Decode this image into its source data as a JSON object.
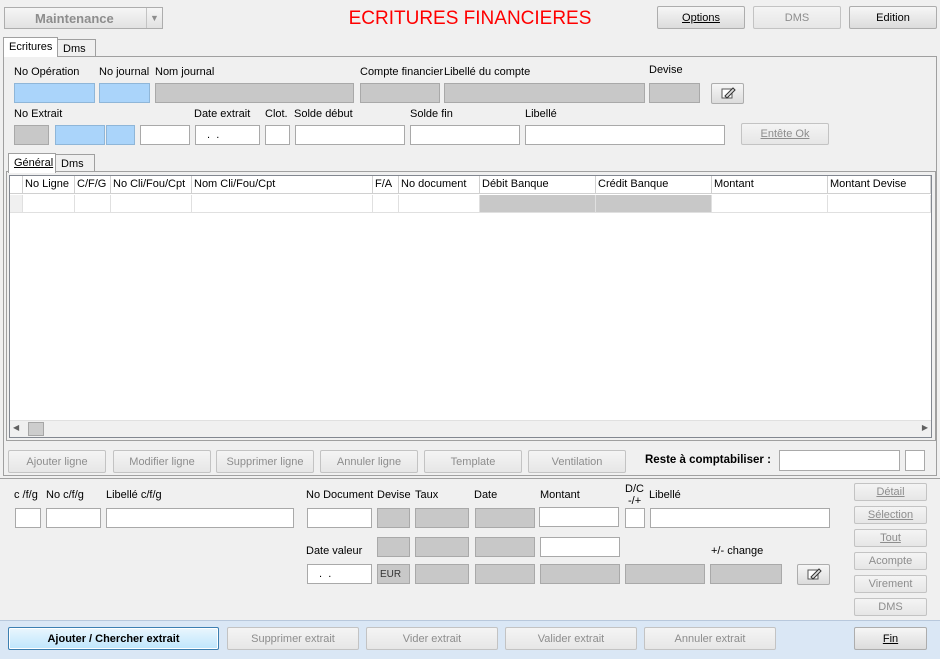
{
  "header": {
    "module_select": "Maintenance",
    "title": "ECRITURES FINANCIERES",
    "options_label": "Options",
    "dms_label": "DMS",
    "edition_label": "Edition"
  },
  "tabs": {
    "top": [
      "Ecritures",
      "Dms"
    ],
    "sub": [
      "Général",
      "Dms"
    ]
  },
  "form": {
    "no_operation": "No Opération",
    "no_journal": "No journal",
    "nom_journal": "Nom journal",
    "compte_financier": "Compte financier",
    "libelle_compte": "Libellé du compte",
    "devise": "Devise",
    "no_extrait": "No Extrait",
    "date_extrait": "Date extrait",
    "date_extrait_value": " .  .",
    "clot": "Clot.",
    "solde_debut": "Solde début",
    "solde_fin": "Solde fin",
    "libelle": "Libellé",
    "entete_ok": "Entête Ok"
  },
  "grid": {
    "columns": [
      "No Ligne",
      "C/F/G",
      "No Cli/Fou/Cpt",
      "Nom Cli/Fou/Cpt",
      "F/A",
      "No document",
      "Débit Banque",
      "Crédit Banque",
      "Montant",
      "Montant Devise"
    ]
  },
  "line_buttons": {
    "ajouter": "Ajouter ligne",
    "modifier": "Modifier ligne",
    "supprimer": "Supprimer ligne",
    "annuler": "Annuler ligne",
    "template": "Template",
    "ventilation": "Ventilation",
    "reste_label": "Reste à comptabiliser :"
  },
  "detail": {
    "cfg": "c /f/g",
    "no_cfg": "No c/f/g",
    "libelle_cfg": "Libellé c/f/g",
    "no_document": "No Document",
    "devise": "Devise",
    "taux": "Taux",
    "date": "Date",
    "montant": "Montant",
    "dc": "D/C",
    "dc2": "-/+",
    "libelle": "Libellé",
    "date_valeur": "Date valeur",
    "date_valeur_value": " .  .",
    "devise_value": "EUR",
    "change": "+/- change"
  },
  "side_buttons": [
    "Détail",
    "Sélection",
    "Tout",
    "Acompte",
    "Virement",
    "DMS"
  ],
  "footer": {
    "ajouter_chercher": "Ajouter / Chercher extrait",
    "supprimer": "Supprimer extrait",
    "vider": "Vider extrait",
    "valider": "Valider extrait",
    "annuler": "Annuler extrait",
    "fin": "Fin"
  }
}
